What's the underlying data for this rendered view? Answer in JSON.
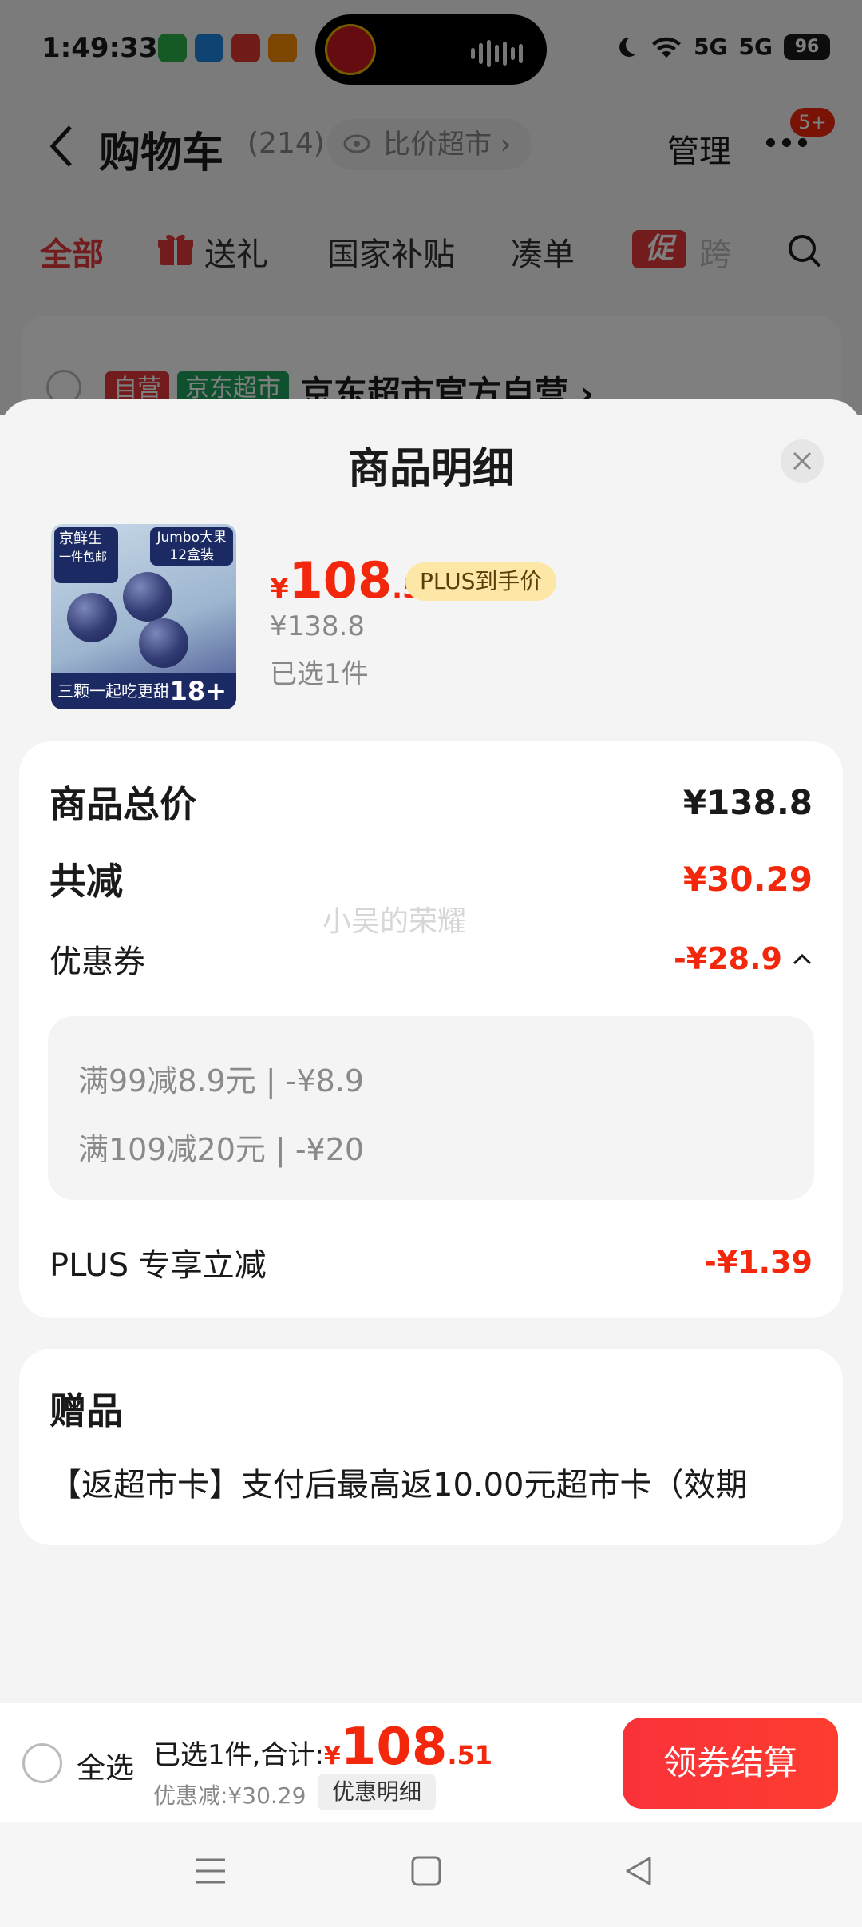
{
  "status_bar": {
    "time": "1:49:33",
    "battery": "96",
    "signal1": "5G",
    "signal2": "5G"
  },
  "cart_header": {
    "title": "购物车",
    "count": "(214)",
    "compare_label": "比价超市",
    "manage_label": "管理",
    "badge": "5+"
  },
  "filter_tabs": [
    {
      "label": "全部",
      "active": true
    },
    {
      "label": "送礼"
    },
    {
      "label": "国家补贴"
    },
    {
      "label": "凑单"
    },
    {
      "label": "跨",
      "icon_text": "促"
    }
  ],
  "store": {
    "tag_self": "自营",
    "tag_jd": "京东超市",
    "name": "京东超市官方自营 ›"
  },
  "sheet": {
    "title": "商品明细",
    "product": {
      "image_tags": {
        "brand": "京鲜生",
        "size": "Jumbo大果",
        "pack": "12盒装",
        "slogan": "三颗一起吃更甜",
        "diameter": "18+",
        "shipping": "一件包邮"
      },
      "price_symbol": "¥",
      "price_int": "108",
      "price_dec": ".51",
      "plus_tag": "PLUS到手价",
      "original_price": "¥138.8",
      "selected": "已选1件"
    },
    "summary": {
      "total_label": "商品总价",
      "total_value": "¥138.8",
      "reduce_label": "共减",
      "reduce_value": "¥30.29",
      "coupon_label": "优惠券",
      "coupon_value": "-¥28.9",
      "coupons": [
        "满99减8.9元 | -¥8.9",
        "满109减20元 | -¥20"
      ],
      "plus_label": "PLUS 专享立减",
      "plus_value": "-¥1.39",
      "watermark": "小吴的荣耀"
    },
    "gift": {
      "title": "赠品",
      "text": "【返超市卡】支付后最高返10.00元超市卡（效期"
    }
  },
  "checkout": {
    "select_all": "全选",
    "total_label": "已选1件,合计:",
    "price_symbol": "¥",
    "price_int": "108",
    "price_dec": ".51",
    "discount": "优惠减:¥30.29",
    "detail_label": "优惠明细",
    "checkout_label": "领券结算"
  },
  "colors": {
    "accent_red": "#f2270c",
    "plus_gold": "#fde7a6"
  }
}
